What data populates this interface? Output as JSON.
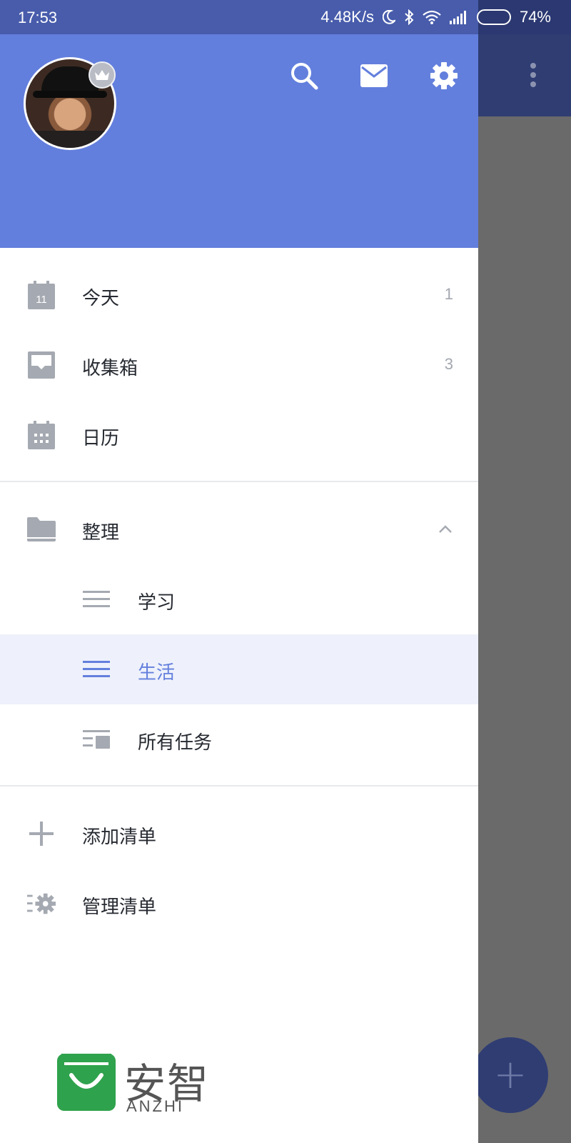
{
  "status_bar": {
    "time": "17:53",
    "network_speed": "4.48K/s",
    "battery": "74%",
    "battery_level": 0.74
  },
  "background_app": {
    "fab_label": "+",
    "more_icon": "more-vert-icon"
  },
  "header": {
    "avatar_badge_icon": "crown-icon",
    "actions": [
      "search-icon",
      "mail-icon",
      "gear-icon"
    ]
  },
  "menu": {
    "today": {
      "label": "今天",
      "count": "1",
      "icon_day": "11"
    },
    "inbox": {
      "label": "收集箱",
      "count": "3"
    },
    "calendar": {
      "label": "日历"
    },
    "folder": {
      "label": "整理",
      "expanded": true
    },
    "lists": [
      {
        "label": "学习",
        "selected": false
      },
      {
        "label": "生活",
        "selected": true
      },
      {
        "label": "所有任务",
        "selected": false
      }
    ],
    "add_list": {
      "label": "添加清单"
    },
    "manage_list": {
      "label": "管理清单"
    }
  },
  "watermark": {
    "logo_cn": "安智",
    "logo_en": "ANZHI"
  },
  "colors": {
    "header": "#637fdd",
    "accent": "#637fdd",
    "selected_bg": "#eef1fb",
    "icon_gray": "#a5a9b1"
  }
}
